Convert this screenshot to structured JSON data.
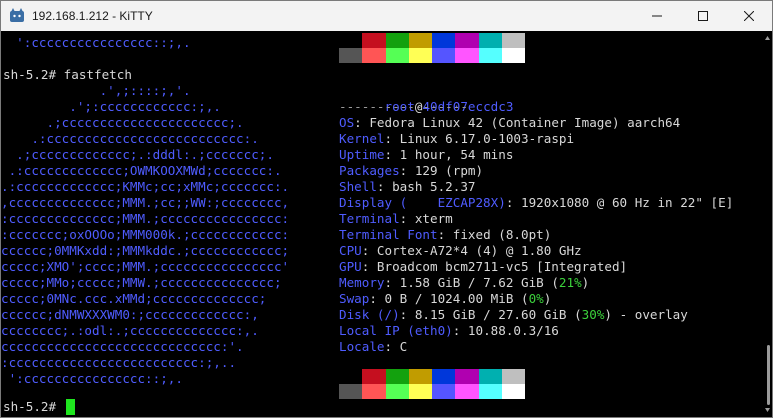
{
  "window": {
    "title": "192.168.1.212 - KiTTY"
  },
  "icons": {
    "app": "kitty-cat-icon",
    "minimize": "minimize-icon",
    "maximize": "maximize-icon",
    "close": "close-icon"
  },
  "terminal": {
    "art_top_line": "  ':cccccccccccccccc::;,.",
    "prompt1": "sh-5.2# fastfetch",
    "art": [
      "             .',;::::;,'.",
      "         .';:cccccccccccc:;,.",
      "      .;cccccccccccccccccccccc;.",
      "    .:cccccccccccccccccccccccccc:.",
      "  .;ccccccccccccc;.:dddl:.;ccccccc;.",
      " .:ccccccccccccc;OWMKOOXMWd;ccccccc:.",
      ".:ccccccccccccc;KMMc;cc;xMMc;ccccccc:.",
      ",cccccccccccccc;MMM.;cc;;WW:;cccccccc,",
      ":cccccccccccccc;MMM.;cccccccccccccccc:",
      ":ccccccc;oxOOOo;MMM000k.;cccccccccccc:",
      "cccccc;0MMKxdd:;MMMkddc.;cccccccccccc;",
      "ccccc;XMO';cccc;MMM.;cccccccccccccccc'",
      "ccccc;MMo;ccccc;MMW.;ccccccccccccccc;",
      "ccccc;0MNc.ccc.xMMd;cccccccccccccc;",
      "cccccc;dNMWXXXWM0:;ccccccccccccc:,",
      "cccccccc;.:odl:.;cccccccccccccc:,.",
      "ccccccccccccccccccccccccccccc:'.",
      ":ccccccccccccccccccccccccc:;,..",
      " ':cccccccccccccccc::;,."
    ],
    "info": {
      "user": "root",
      "at": "@",
      "host": "40df07eccdc3",
      "separator": "-----------------",
      "rows": [
        {
          "key": "OS",
          "value": "Fedora Linux 42 (Container Image) aarch64"
        },
        {
          "key": "Kernel",
          "value": "Linux 6.17.0-1003-raspi"
        },
        {
          "key": "Uptime",
          "value": "1 hour, 54 mins"
        },
        {
          "key": "Packages",
          "value": "129 (rpm)"
        },
        {
          "key": "Shell",
          "value": "bash 5.2.37"
        },
        {
          "key": "Display (    EZCAP28X)",
          "value": "1920x1080 @ 60 Hz in 22\" [E]"
        },
        {
          "key": "Terminal",
          "value": "xterm"
        },
        {
          "key": "Terminal Font",
          "value": "fixed (8.0pt)"
        },
        {
          "key": "CPU",
          "value": "Cortex-A72*4 (4) @ 1.80 GHz"
        },
        {
          "key": "GPU",
          "value": "Broadcom bcm2711-vc5 [Integrated]"
        },
        {
          "key": "Memory",
          "value": "1.58 GiB / 7.62 GiB",
          "pct": "21%"
        },
        {
          "key": "Swap",
          "value": "0 B / 1024.00 MiB",
          "pct": "0%"
        },
        {
          "key": "Disk (/)",
          "value": "8.15 GiB / 27.60 GiB",
          "pct": "30%",
          "suffix": " - overlay"
        },
        {
          "key": "Local IP (eth0)",
          "value": "10.88.0.3/16"
        },
        {
          "key": "Locale",
          "value": "C"
        }
      ]
    },
    "prompt2": "sh-5.2# ",
    "palette_top": [
      "#000000",
      "#c50f1f",
      "#13a10e",
      "#c19c00",
      "#0037da",
      "#b000b0",
      "#00b0b0",
      "#bfbfbf"
    ],
    "palette_bottom": [
      "#555555",
      "#ff5555",
      "#55ff55",
      "#ffff55",
      "#5555ff",
      "#ff55ff",
      "#55ffff",
      "#ffffff"
    ]
  }
}
